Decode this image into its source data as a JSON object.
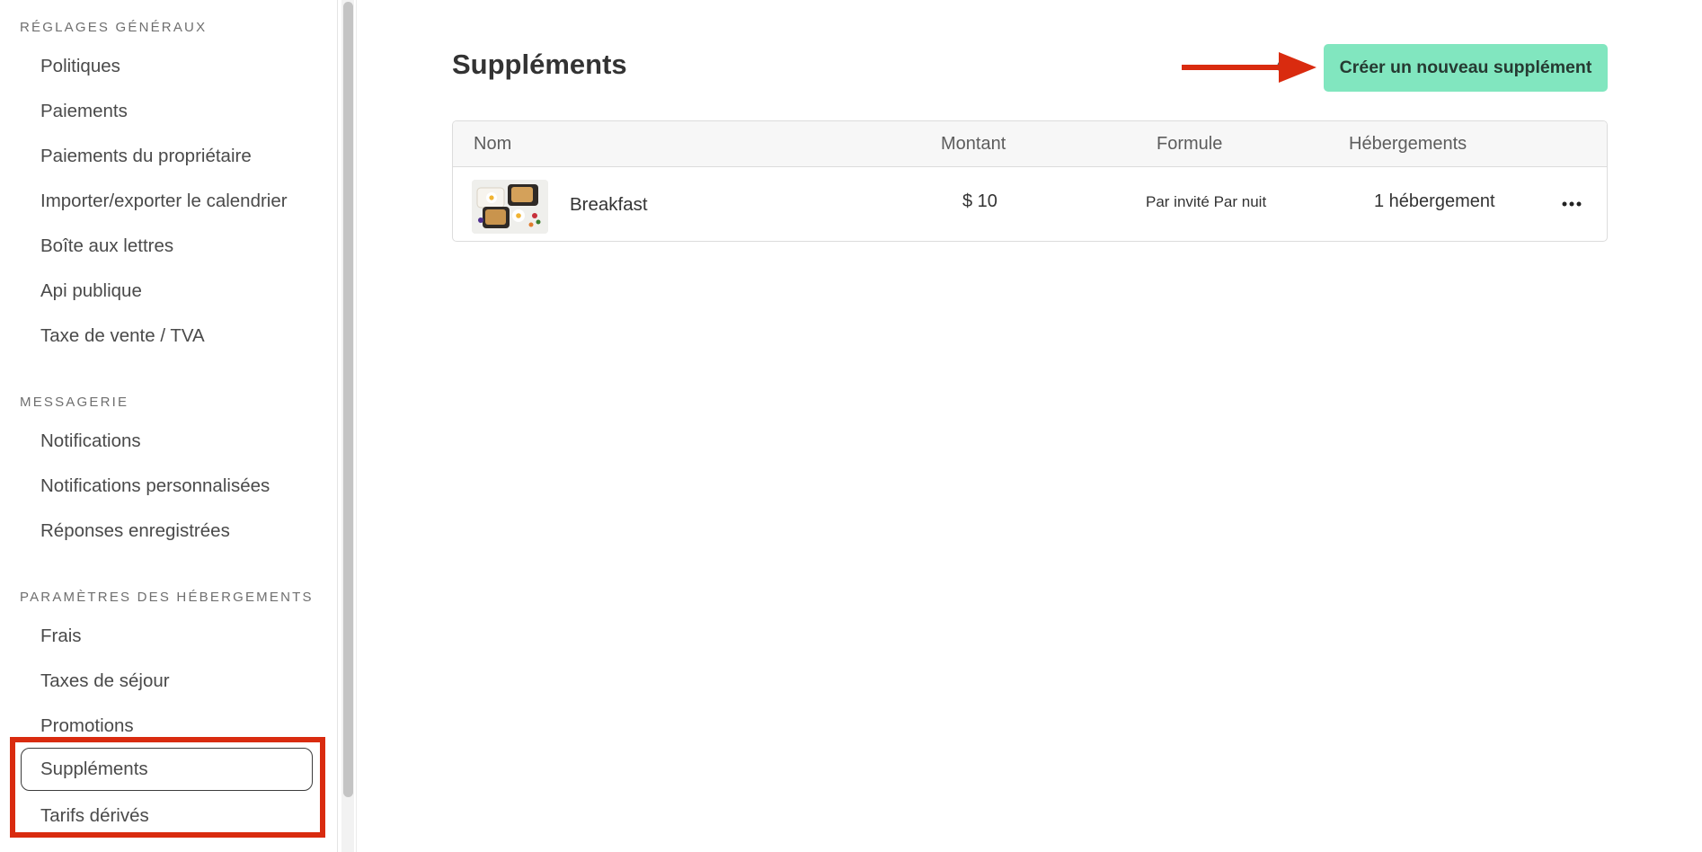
{
  "sidebar": {
    "sections": [
      {
        "heading": "RÉGLAGES GÉNÉRAUX",
        "items": [
          "Politiques",
          "Paiements",
          "Paiements du propriétaire",
          "Importer/exporter le calendrier",
          "Boîte aux lettres",
          "Api publique",
          "Taxe de vente / TVA"
        ]
      },
      {
        "heading": "MESSAGERIE",
        "items": [
          "Notifications",
          "Notifications personnalisées",
          "Réponses enregistrées"
        ]
      },
      {
        "heading": "PARAMÈTRES DES HÉBERGEMENTS",
        "items": [
          "Frais",
          "Taxes de séjour",
          "Promotions",
          "Suppléments",
          "Tarifs dérivés"
        ]
      }
    ],
    "active_item": "Suppléments"
  },
  "main": {
    "title": "Suppléments",
    "create_button": "Créer un nouveau supplément",
    "table": {
      "columns": [
        "Nom",
        "Montant",
        "Formule",
        "Hébergements"
      ],
      "rows": [
        {
          "name": "Breakfast",
          "amount": "$ 10",
          "formula": "Par invité Par nuit",
          "accommodations": "1 hébergement",
          "thumbnail": "breakfast-photo",
          "actions_icon": "more-horizontal-icon"
        }
      ]
    }
  },
  "colors": {
    "primary_button": "#81e6bf",
    "annotation": "#d92b0f",
    "active_border": "#3c3c3c"
  }
}
